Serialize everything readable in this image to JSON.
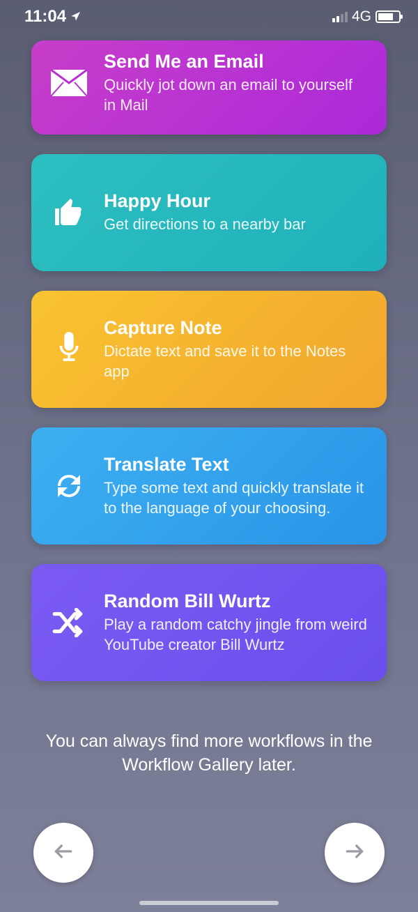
{
  "status": {
    "time": "11:04",
    "network_label": "4G"
  },
  "cards": [
    {
      "title": "Send Me an Email",
      "subtitle": "Quickly jot down an email to yourself in Mail"
    },
    {
      "title": "Happy Hour",
      "subtitle": "Get directions to a nearby bar"
    },
    {
      "title": "Capture Note",
      "subtitle": "Dictate text and save it to the Notes app"
    },
    {
      "title": "Translate Text",
      "subtitle": "Type some text and quickly translate it to the language of your choosing."
    },
    {
      "title": "Random Bill Wurtz",
      "subtitle": "Play a random catchy jingle from weird YouTube creator Bill Wurtz"
    }
  ],
  "footer": {
    "text": "You can always find more workflows in the Workflow Gallery later."
  }
}
